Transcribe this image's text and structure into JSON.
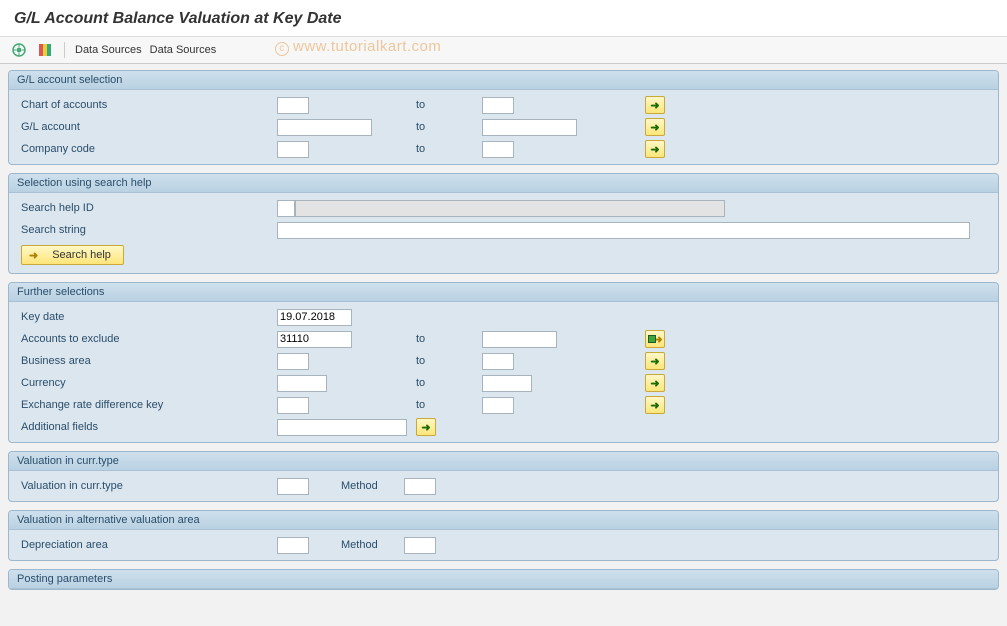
{
  "header": {
    "title": "G/L Account Balance Valuation at Key Date"
  },
  "toolbar": {
    "execute_icon": "execute",
    "variant_icon": "variant",
    "data_sources_1": "Data Sources",
    "data_sources_2": "Data Sources"
  },
  "watermark": "www.tutorialkart.com",
  "groups": {
    "gl_selection": {
      "title": "G/L account selection",
      "rows": {
        "chart": {
          "label": "Chart of accounts",
          "to": "to"
        },
        "account": {
          "label": "G/L account",
          "to": "to"
        },
        "company": {
          "label": "Company code",
          "to": "to"
        }
      }
    },
    "search_help": {
      "title": "Selection using search help",
      "rows": {
        "id": {
          "label": "Search help ID"
        },
        "string": {
          "label": "Search string"
        }
      },
      "button": "Search help"
    },
    "further": {
      "title": "Further selections",
      "rows": {
        "keydate": {
          "label": "Key date",
          "value": "19.07.2018"
        },
        "exclude": {
          "label": "Accounts to exclude",
          "value": "31110",
          "to": "to"
        },
        "bizarea": {
          "label": "Business area",
          "to": "to"
        },
        "currency": {
          "label": "Currency",
          "to": "to"
        },
        "exchange": {
          "label": "Exchange rate difference key",
          "to": "to"
        },
        "addfields": {
          "label": "Additional fields"
        }
      }
    },
    "val_curr": {
      "title": "Valuation in curr.type",
      "row": {
        "label": "Valuation in curr.type",
        "method": "Method"
      }
    },
    "val_alt": {
      "title": "Valuation in alternative valuation area",
      "row": {
        "label": "Depreciation area",
        "method": "Method"
      }
    },
    "posting": {
      "title": "Posting parameters"
    }
  }
}
